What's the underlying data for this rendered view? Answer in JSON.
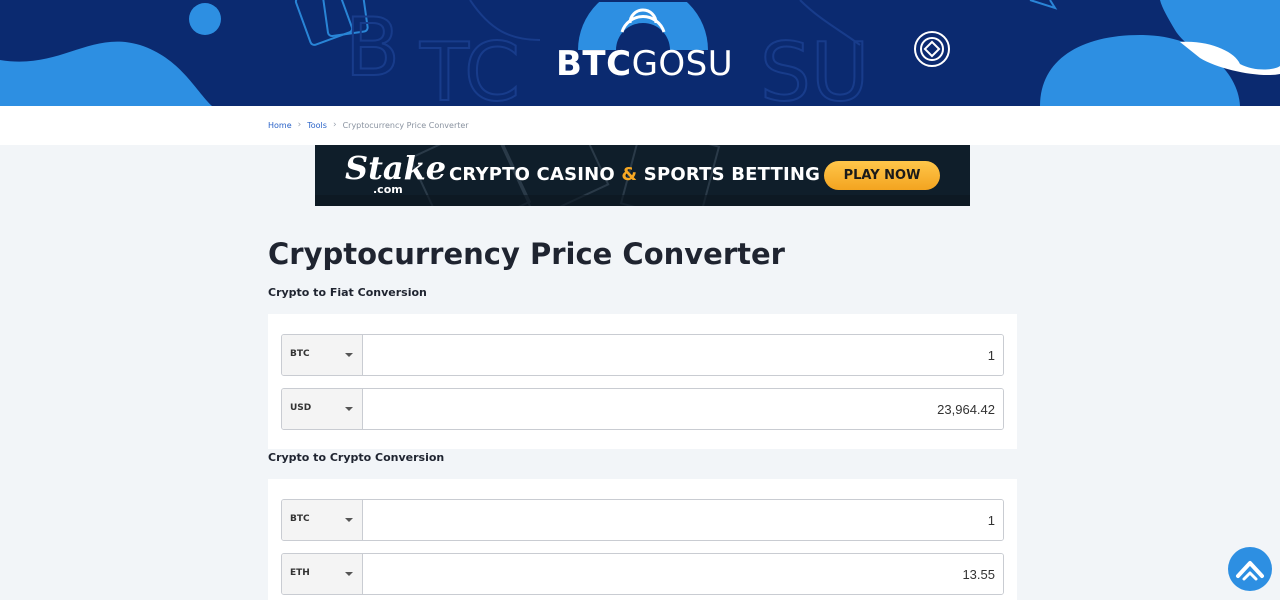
{
  "header": {
    "logo_bold": "BTC",
    "logo_light": "GOSU"
  },
  "breadcrumb": {
    "items": [
      "Home",
      "Tools",
      "Cryptocurrency Price Converter"
    ]
  },
  "banner": {
    "brand": "Stake",
    "brand_sub": ".com",
    "tagline_part1": "CRYPTO CASINO ",
    "tagline_amp": "&",
    "tagline_part2": " SPORTS BETTING",
    "cta": "PLAY NOW"
  },
  "page": {
    "title": "Cryptocurrency Price Converter"
  },
  "fiat_conversion": {
    "label": "Crypto to Fiat Conversion",
    "rows": [
      {
        "currency": "BTC",
        "amount": "1"
      },
      {
        "currency": "USD",
        "amount": "23,964.42"
      }
    ]
  },
  "crypto_conversion": {
    "label": "Crypto to Crypto Conversion",
    "rows": [
      {
        "currency": "BTC",
        "amount": "1"
      },
      {
        "currency": "ETH",
        "amount": "13.55"
      }
    ]
  },
  "icons": {
    "scroll_top": "chevron-up-icon",
    "caret": "caret-down-icon"
  },
  "colors": {
    "header_bg": "#0b2a70",
    "accent_blue": "#2d8fe2",
    "link": "#2a63c8",
    "cta": "#f3a420"
  }
}
